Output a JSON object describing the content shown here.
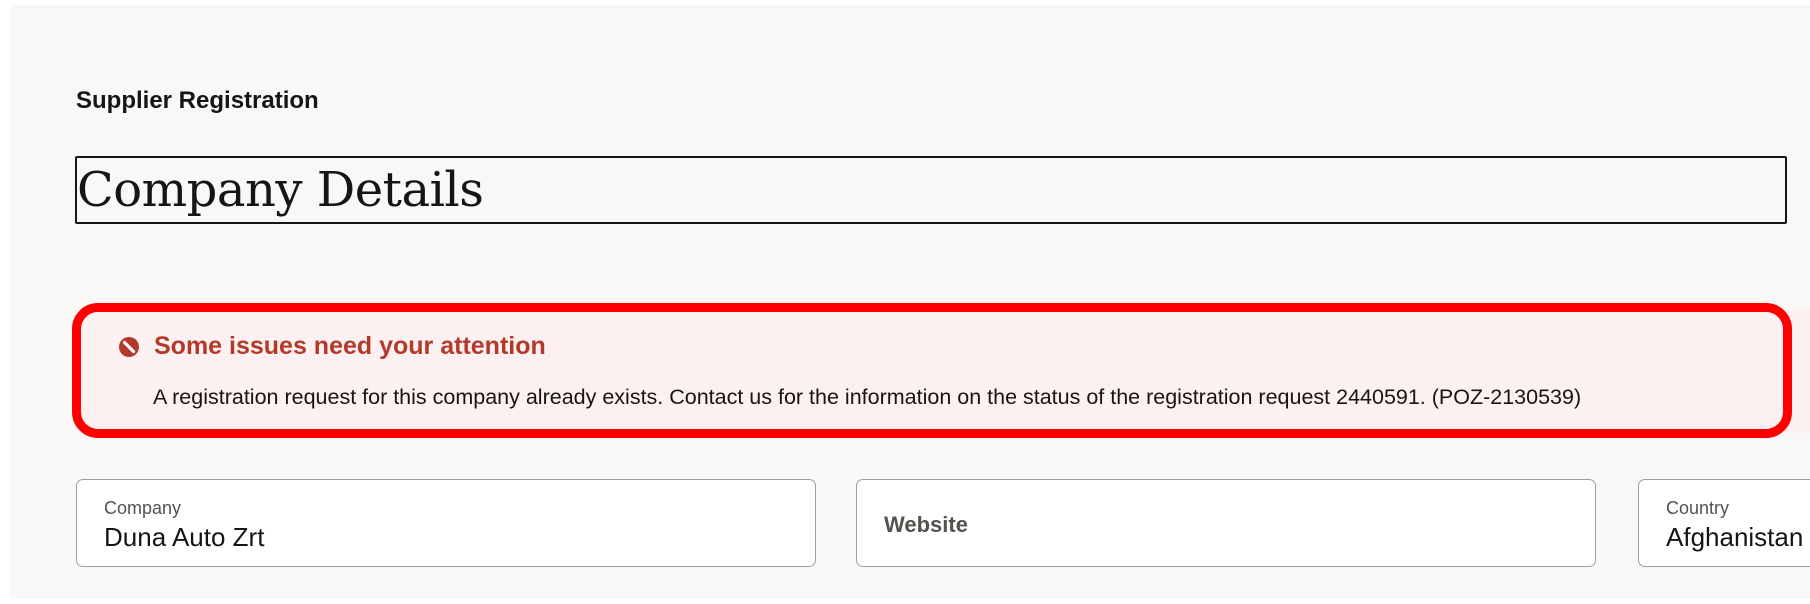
{
  "breadcrumb": "Supplier Registration",
  "page_title": "Company Details",
  "message": {
    "icon": "error-icon",
    "title": "Some issues need your attention",
    "body": "A registration request for this company already exists. Contact us for the information on the status of the registration request 2440591. (POZ-2130539)"
  },
  "fields": {
    "company": {
      "label": "Company",
      "value": "Duna Auto Zrt"
    },
    "website": {
      "label": "Website",
      "value": ""
    },
    "country": {
      "label": "Country",
      "value": "Afghanistan"
    }
  },
  "colors": {
    "error_text": "#b33a2b",
    "highlight_border": "#ff0000",
    "message_background": "#fcf1f0",
    "page_background": "#f9f8f6"
  }
}
